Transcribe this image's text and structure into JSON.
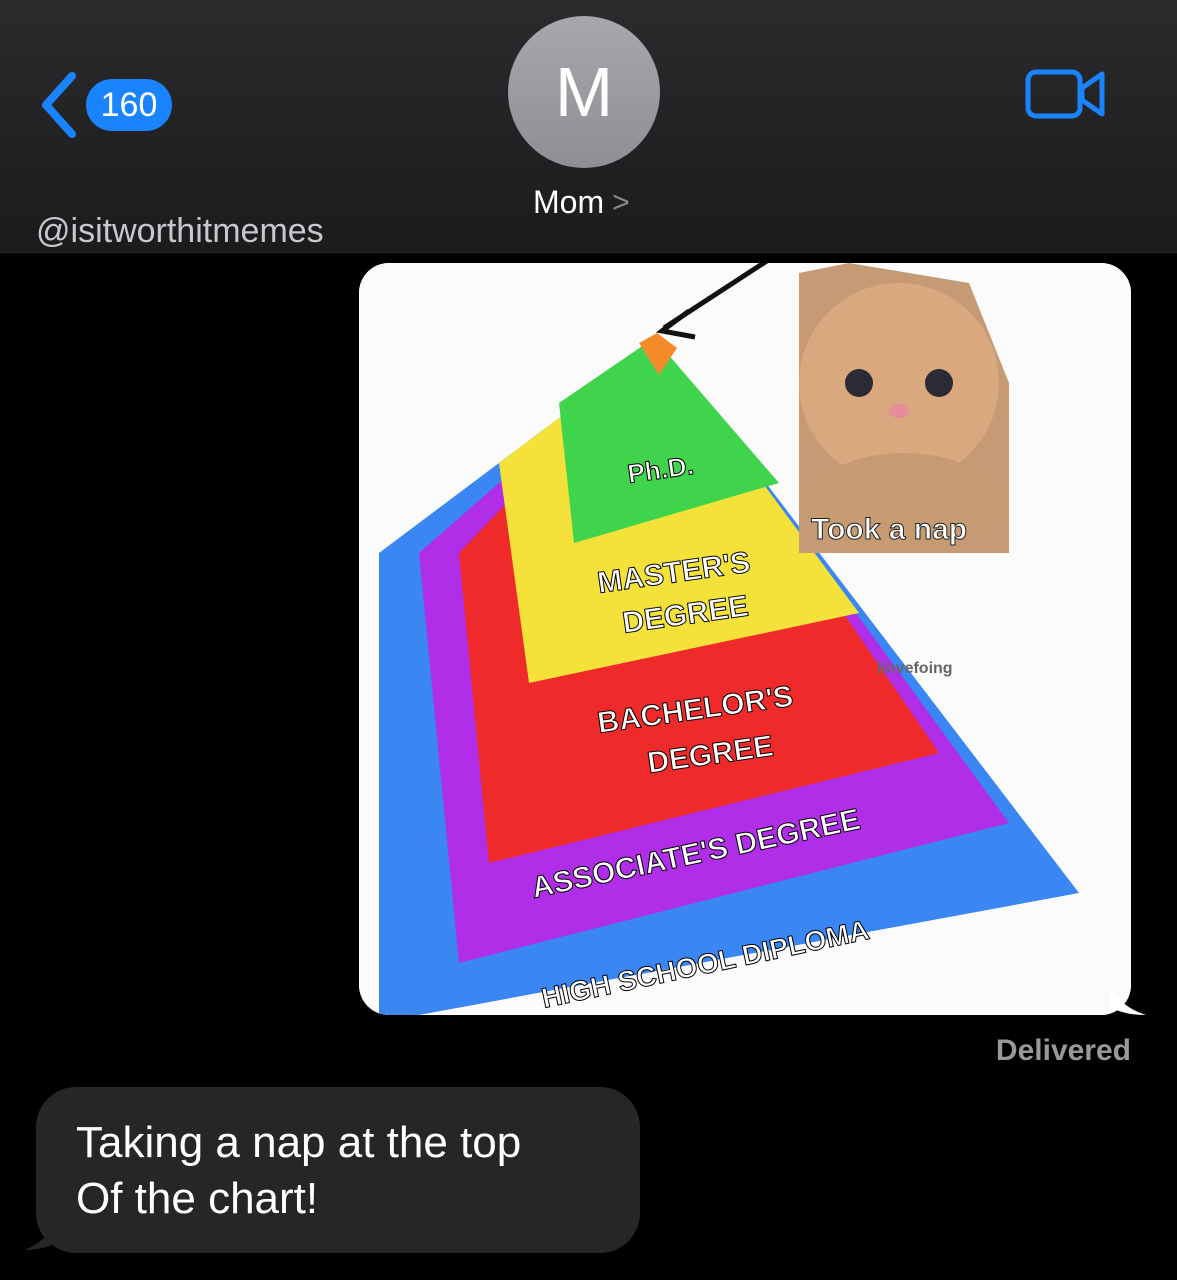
{
  "header": {
    "back_count": "160",
    "avatar_initial": "M",
    "contact_name": "Mom",
    "contact_chevron": ">",
    "icons": [
      "chevron-left-icon",
      "video-camera-icon",
      "chevron-right-icon"
    ],
    "accent_color": "#1a84ff"
  },
  "watermark": "@isitworthitmemes",
  "image_message": {
    "pyramid_levels": [
      {
        "label_lines": [
          "Ph.D."
        ],
        "color": "#3fd44b"
      },
      {
        "label_lines": [
          "MASTER'S",
          "DEGREE"
        ],
        "color": "#f4e23a"
      },
      {
        "label_lines": [
          "BACHELOR'S",
          "DEGREE"
        ],
        "color": "#ee2a2a"
      },
      {
        "label_lines": [
          "ASSOCIATE'S DEGREE"
        ],
        "color": "#b02ee8"
      },
      {
        "label_lines": [
          "HIGH SCHOOL DIPLOMA"
        ],
        "color": "#3a86f2"
      }
    ],
    "cat_caption": "Took a nap",
    "image_watermark": "ilovefoing"
  },
  "status": "Delivered",
  "incoming_message": {
    "lines": [
      "Taking a nap at the top",
      "Of the chart!"
    ]
  }
}
